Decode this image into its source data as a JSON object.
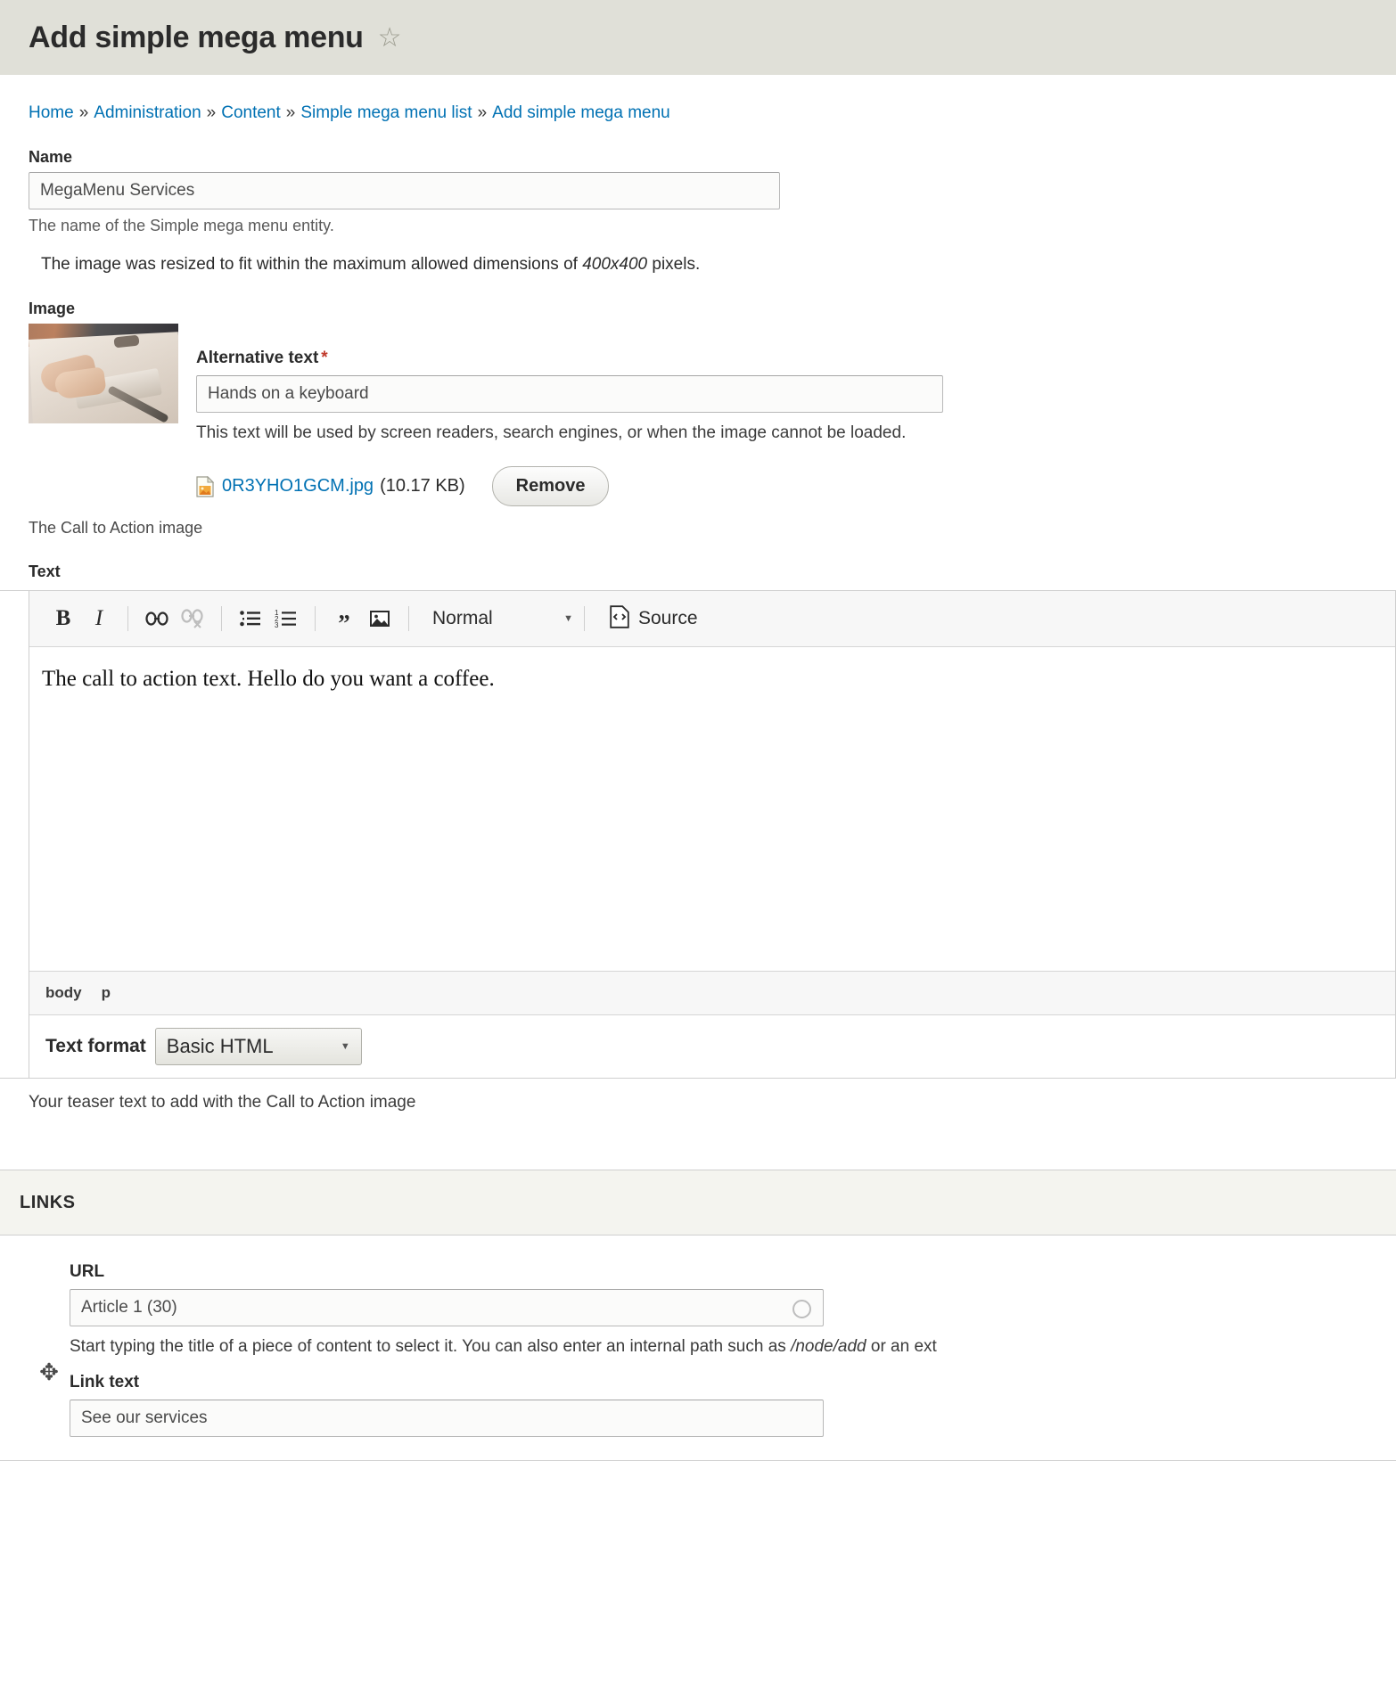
{
  "header": {
    "title": "Add simple mega menu",
    "star_icon": "star-outline-icon"
  },
  "breadcrumb": {
    "items": [
      "Home",
      "Administration",
      "Content",
      "Simple mega menu list",
      "Add simple mega menu"
    ],
    "separator": "»"
  },
  "name_field": {
    "label": "Name",
    "value": "MegaMenu Services",
    "description": "The name of the Simple mega menu entity."
  },
  "status_message": {
    "prefix": "The image was resized to fit within the maximum allowed dimensions of ",
    "dimensions": "400x400",
    "suffix": " pixels."
  },
  "image_field": {
    "label": "Image",
    "thumbnail_alt": "Hands on a keyboard",
    "alt_label": "Alternative text",
    "required_marker": "*",
    "alt_value": "Hands on a keyboard",
    "alt_description": "This text will be used by screen readers, search engines, or when the image cannot be loaded.",
    "file_icon": "file-image-icon",
    "file_name": "0R3YHO1GCM.jpg",
    "file_size": "(10.17 KB)",
    "remove_button": "Remove",
    "description": "The Call to Action image"
  },
  "text_field": {
    "label": "Text",
    "toolbar": {
      "bold": "B",
      "italic": "I",
      "link_icon": "link-icon",
      "unlink_icon": "unlink-icon",
      "bulleted_list_icon": "bulleted-list-icon",
      "numbered_list_icon": "numbered-list-icon",
      "blockquote_icon": "blockquote-icon",
      "image_icon": "image-icon",
      "heading_value": "Normal",
      "caret_icon": "chevron-down-icon",
      "source_icon": "source-code-icon",
      "source_label": "Source"
    },
    "body": "The call to action text. Hello do you want a coffee.",
    "element_path": [
      "body",
      "p"
    ],
    "format_label": "Text format",
    "format_value": "Basic HTML",
    "description": "Your teaser text to add with the Call to Action image"
  },
  "links_section": {
    "title": "LINKS",
    "drag_icon": "drag-move-icon",
    "url_label": "URL",
    "url_value": "Article 1 (30)",
    "throbber_icon": "throbber-icon",
    "url_description_prefix": "Start typing the title of a piece of content to select it. You can also enter an internal path such as ",
    "url_description_path": "/node/add",
    "url_description_suffix": " or an ext",
    "link_text_label": "Link text",
    "link_text_value": "See our services"
  },
  "colors": {
    "title_bar_bg": "#e0e0d8",
    "link_blue": "#0071b3",
    "required_red": "#c0392b",
    "panel_bg": "#f4f4ef",
    "toolbar_bg": "#f7f7f7"
  }
}
